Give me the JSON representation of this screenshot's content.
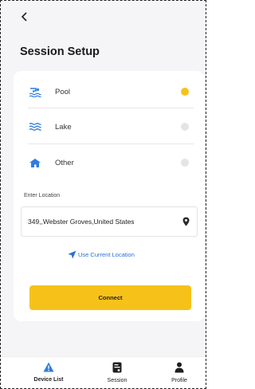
{
  "header": {
    "back_icon": "chevron-left-icon",
    "title": "Session Setup"
  },
  "water_options": [
    {
      "label": "Pool",
      "icon": "pool-icon",
      "selected": true
    },
    {
      "label": "Lake",
      "icon": "lake-waves-icon",
      "selected": false
    },
    {
      "label": "Other",
      "icon": "house-icon",
      "selected": false
    }
  ],
  "location": {
    "label": "Enter Location",
    "value": "349,,Webster Groves,United States",
    "pin_icon": "map-pin-icon",
    "use_current_label": "Use Current Location",
    "use_current_icon": "navigation-arrow-icon"
  },
  "connect_label": "Connect",
  "tabs": [
    {
      "label": "Device List",
      "icon": "warning-triangle-icon",
      "active": true
    },
    {
      "label": "Session",
      "icon": "session-device-icon",
      "active": false
    },
    {
      "label": "Profile",
      "icon": "person-icon",
      "active": false
    }
  ],
  "colors": {
    "accent_yellow": "#f6c21a",
    "link_blue": "#2b6fd6",
    "icon_blue": "#2f7de0"
  }
}
